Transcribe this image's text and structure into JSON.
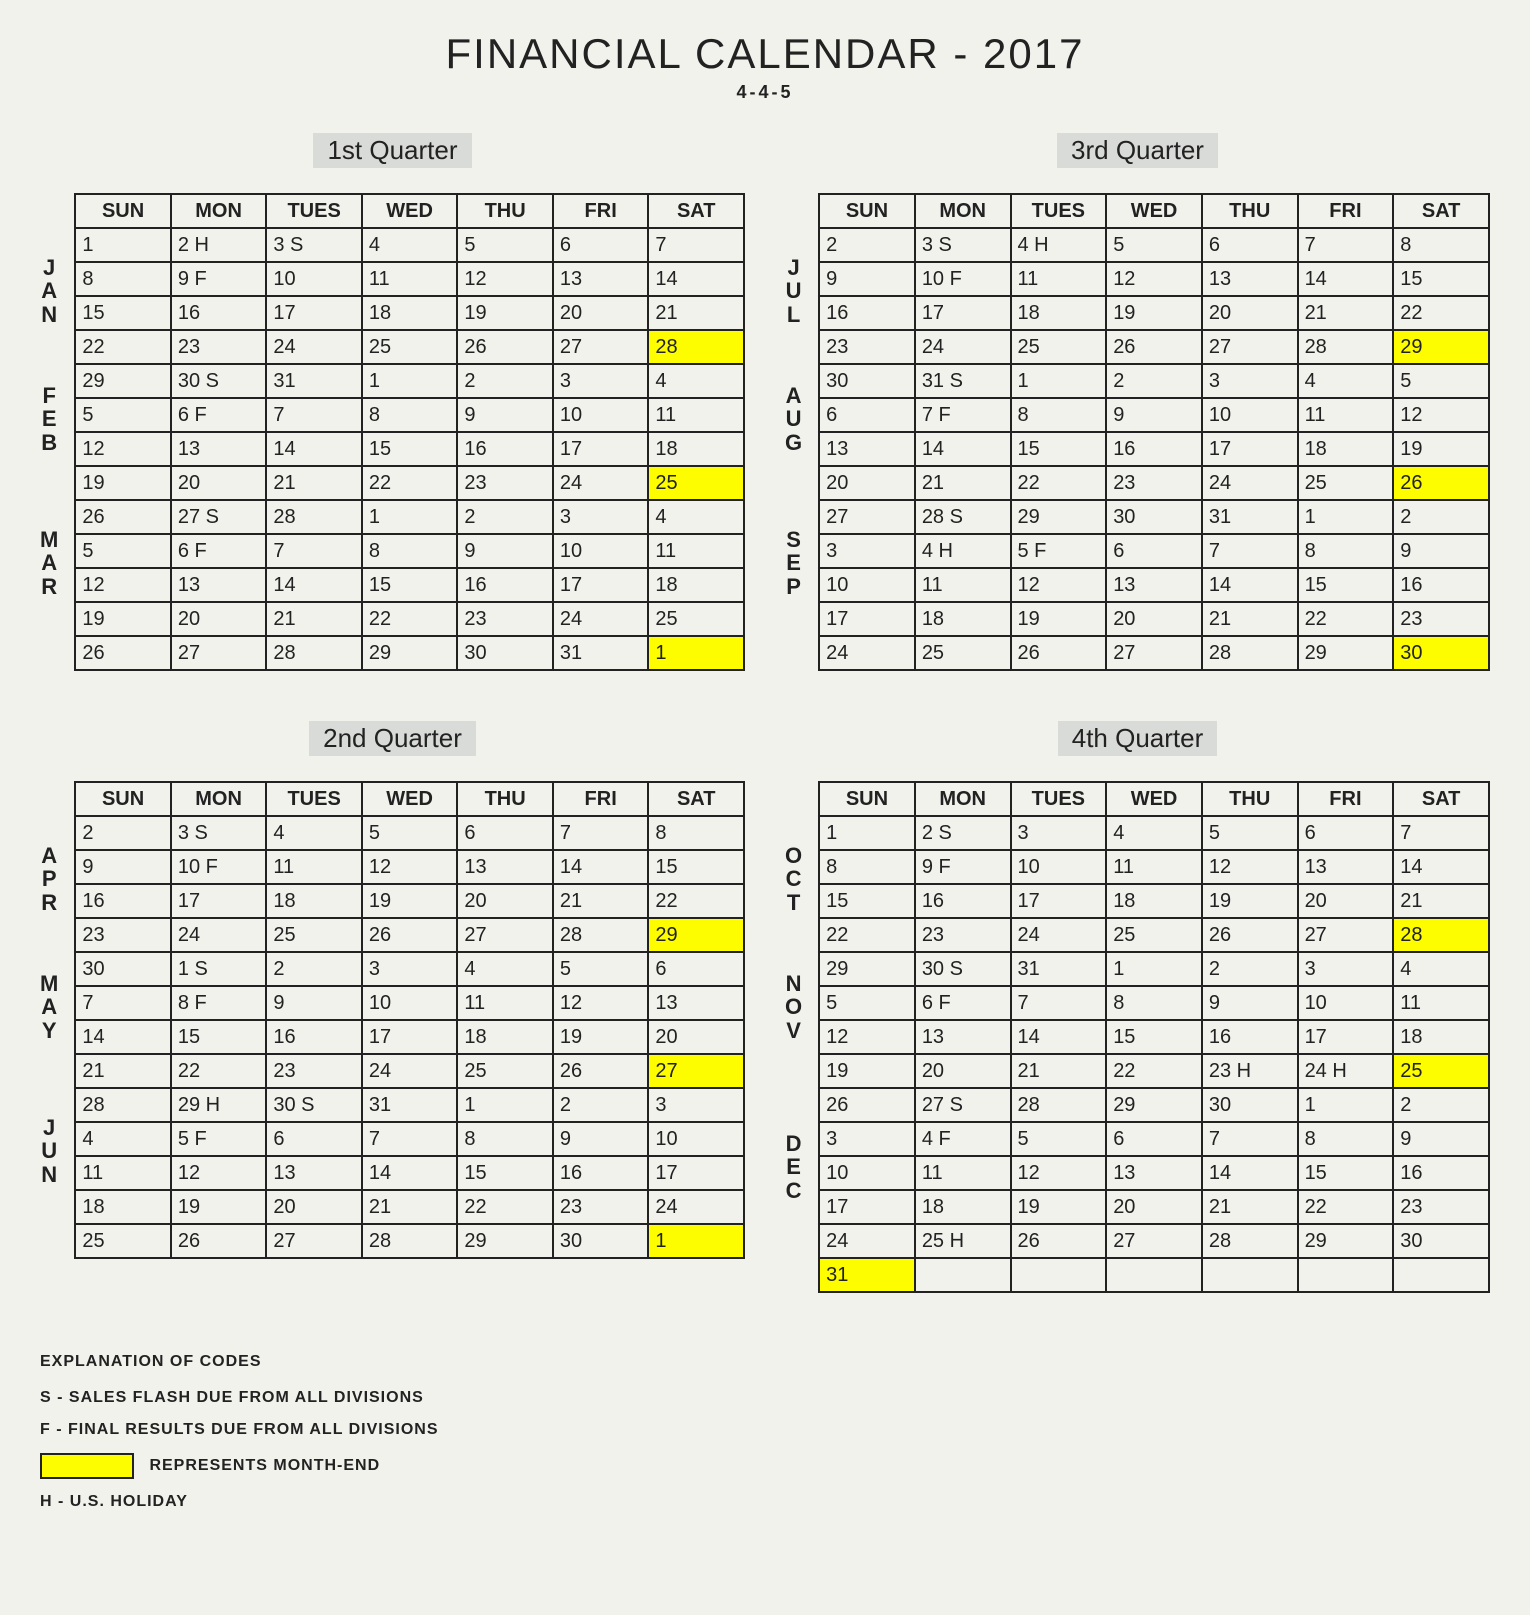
{
  "title": "FINANCIAL CALENDAR - 2017",
  "subtitle": "4-4-5",
  "day_headers": [
    "SUN",
    "MON",
    "TUES",
    "WED",
    "THU",
    "FRI",
    "SAT"
  ],
  "quarters": [
    {
      "title": "1st Quarter",
      "months": [
        {
          "label": "JAN",
          "rows": 4,
          "weeks": [
            [
              "1",
              "2 H",
              "3 S",
              "4",
              "5",
              "6",
              "7"
            ],
            [
              "8",
              "9 F",
              "10",
              "11",
              "12",
              "13",
              "14"
            ],
            [
              "15",
              "16",
              "17",
              "18",
              "19",
              "20",
              "21"
            ],
            [
              "22",
              "23",
              "24",
              "25",
              "26",
              "27",
              {
                "t": "28",
                "hl": true
              }
            ]
          ]
        },
        {
          "label": "FEB",
          "rows": 4,
          "weeks": [
            [
              "29",
              "30 S",
              "31",
              "1",
              "2",
              "3",
              "4"
            ],
            [
              "5",
              "6 F",
              "7",
              "8",
              "9",
              "10",
              "11"
            ],
            [
              "12",
              "13",
              "14",
              "15",
              "16",
              "17",
              "18"
            ],
            [
              "19",
              "20",
              "21",
              "22",
              "23",
              "24",
              {
                "t": "25",
                "hl": true
              }
            ]
          ]
        },
        {
          "label": "MAR",
          "rows": 5,
          "weeks": [
            [
              "26",
              "27 S",
              "28",
              "1",
              "2",
              "3",
              "4"
            ],
            [
              "5",
              "6 F",
              "7",
              "8",
              "9",
              "10",
              "11"
            ],
            [
              "12",
              "13",
              "14",
              "15",
              "16",
              "17",
              "18"
            ],
            [
              "19",
              "20",
              "21",
              "22",
              "23",
              "24",
              "25"
            ],
            [
              "26",
              "27",
              "28",
              "29",
              "30",
              "31",
              {
                "t": "1",
                "hl": true
              }
            ]
          ]
        }
      ]
    },
    {
      "title": "3rd Quarter",
      "months": [
        {
          "label": "JUL",
          "rows": 4,
          "weeks": [
            [
              "2",
              "3 S",
              "4 H",
              "5",
              "6",
              "7",
              "8"
            ],
            [
              "9",
              "10 F",
              "11",
              "12",
              "13",
              "14",
              "15"
            ],
            [
              "16",
              "17",
              "18",
              "19",
              "20",
              "21",
              "22"
            ],
            [
              "23",
              "24",
              "25",
              "26",
              "27",
              "28",
              {
                "t": "29",
                "hl": true
              }
            ]
          ]
        },
        {
          "label": "AUG",
          "rows": 4,
          "weeks": [
            [
              "30",
              "31 S",
              "1",
              "2",
              "3",
              "4",
              "5"
            ],
            [
              "6",
              "7 F",
              "8",
              "9",
              "10",
              "11",
              "12"
            ],
            [
              "13",
              "14",
              "15",
              "16",
              "17",
              "18",
              "19"
            ],
            [
              "20",
              "21",
              "22",
              "23",
              "24",
              "25",
              {
                "t": "26",
                "hl": true
              }
            ]
          ]
        },
        {
          "label": "SEP",
          "rows": 5,
          "weeks": [
            [
              "27",
              "28 S",
              "29",
              "30",
              "31",
              "1",
              "2"
            ],
            [
              "3",
              "4 H",
              "5 F",
              "6",
              "7",
              "8",
              "9"
            ],
            [
              "10",
              "11",
              "12",
              "13",
              "14",
              "15",
              "16"
            ],
            [
              "17",
              "18",
              "19",
              "20",
              "21",
              "22",
              "23"
            ],
            [
              "24",
              "25",
              "26",
              "27",
              "28",
              "29",
              {
                "t": "30",
                "hl": true
              }
            ]
          ]
        }
      ]
    },
    {
      "title": "2nd Quarter",
      "months": [
        {
          "label": "APR",
          "rows": 4,
          "weeks": [
            [
              "2",
              "3 S",
              "4",
              "5",
              "6",
              "7",
              "8"
            ],
            [
              "9",
              "10 F",
              "11",
              "12",
              "13",
              "14",
              "15"
            ],
            [
              "16",
              "17",
              "18",
              "19",
              "20",
              "21",
              "22"
            ],
            [
              "23",
              "24",
              "25",
              "26",
              "27",
              "28",
              {
                "t": "29",
                "hl": true
              }
            ]
          ]
        },
        {
          "label": "MAY",
          "rows": 4,
          "weeks": [
            [
              "30",
              "1 S",
              "2",
              "3",
              "4",
              "5",
              "6"
            ],
            [
              "7",
              "8 F",
              "9",
              "10",
              "11",
              "12",
              "13"
            ],
            [
              "14",
              "15",
              "16",
              "17",
              "18",
              "19",
              "20"
            ],
            [
              "21",
              "22",
              "23",
              "24",
              "25",
              "26",
              {
                "t": "27",
                "hl": true
              }
            ]
          ]
        },
        {
          "label": "JUN",
          "rows": 5,
          "weeks": [
            [
              "28",
              "29 H",
              "30 S",
              "31",
              "1",
              "2",
              "3"
            ],
            [
              "4",
              "5 F",
              "6",
              "7",
              "8",
              "9",
              "10"
            ],
            [
              "11",
              "12",
              "13",
              "14",
              "15",
              "16",
              "17"
            ],
            [
              "18",
              "19",
              "20",
              "21",
              "22",
              "23",
              "24"
            ],
            [
              "25",
              "26",
              "27",
              "28",
              "29",
              "30",
              {
                "t": "1",
                "hl": true
              }
            ]
          ]
        }
      ]
    },
    {
      "title": "4th Quarter",
      "months": [
        {
          "label": "OCT",
          "rows": 4,
          "weeks": [
            [
              "1",
              "2 S",
              "3",
              "4",
              "5",
              "6",
              "7"
            ],
            [
              "8",
              "9 F",
              "10",
              "11",
              "12",
              "13",
              "14"
            ],
            [
              "15",
              "16",
              "17",
              "18",
              "19",
              "20",
              "21"
            ],
            [
              "22",
              "23",
              "24",
              "25",
              "26",
              "27",
              {
                "t": "28",
                "hl": true
              }
            ]
          ]
        },
        {
          "label": "NOV",
          "rows": 4,
          "weeks": [
            [
              "29",
              "30 S",
              "31",
              "1",
              "2",
              "3",
              "4"
            ],
            [
              "5",
              "6 F",
              "7",
              "8",
              "9",
              "10",
              "11"
            ],
            [
              "12",
              "13",
              "14",
              "15",
              "16",
              "17",
              "18"
            ],
            [
              "19",
              "20",
              "21",
              "22",
              "23 H",
              "24 H",
              {
                "t": "25",
                "hl": true
              }
            ]
          ]
        },
        {
          "label": "DEC",
          "rows": 6,
          "weeks": [
            [
              "26",
              "27 S",
              "28",
              "29",
              "30",
              "1",
              "2"
            ],
            [
              "3",
              "4 F",
              "5",
              "6",
              "7",
              "8",
              "9"
            ],
            [
              "10",
              "11",
              "12",
              "13",
              "14",
              "15",
              "16"
            ],
            [
              "17",
              "18",
              "19",
              "20",
              "21",
              "22",
              "23"
            ],
            [
              "24",
              "25 H",
              "26",
              "27",
              "28",
              "29",
              "30"
            ],
            [
              {
                "t": "31",
                "hl": true
              },
              "",
              "",
              "",
              "",
              "",
              ""
            ]
          ]
        }
      ]
    }
  ],
  "legend": {
    "title": "EXPLANATION OF CODES",
    "s": "S - SALES FLASH DUE FROM ALL DIVISIONS",
    "f": "F - FINAL RESULTS DUE FROM ALL DIVISIONS",
    "month_end": "REPRESENTS MONTH-END",
    "h": "H - U.S. HOLIDAY"
  }
}
